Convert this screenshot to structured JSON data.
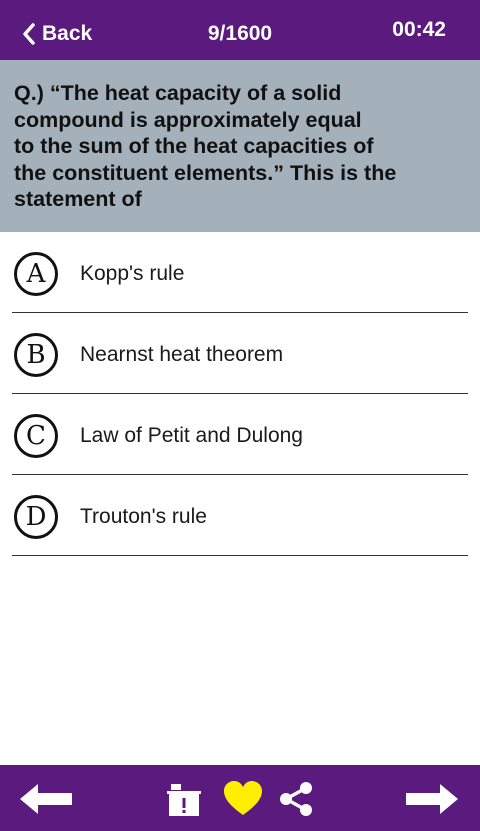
{
  "header": {
    "back_label": "Back",
    "counter": "9/1600",
    "timer": "00:42"
  },
  "question": {
    "lines": [
      "Q.) “The heat capacity of a solid",
      "compound is approximately equal",
      "to the sum of the heat capacities of",
      "the constituent elements.” This is the",
      "statement of"
    ]
  },
  "options": [
    {
      "letter": "A",
      "text": "Kopp's rule"
    },
    {
      "letter": "B",
      "text": "Nearnst heat theorem"
    },
    {
      "letter": "C",
      "text": "Law of Petit and Dulong"
    },
    {
      "letter": "D",
      "text": "Trouton's rule"
    }
  ],
  "footer": {
    "icons": [
      "arrow-left-icon",
      "report-box-icon",
      "heart-icon",
      "share-icon",
      "arrow-right-icon"
    ],
    "heart_color": "#ffee00"
  },
  "colors": {
    "header_bg": "#5a1a7e",
    "question_bg": "#a4b1bb",
    "footer_bg": "#5a1a7e"
  }
}
